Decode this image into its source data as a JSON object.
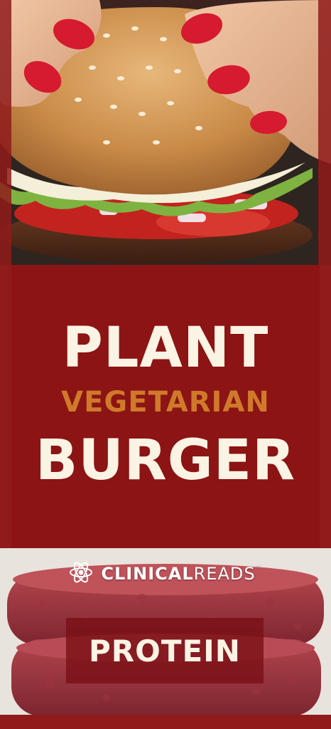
{
  "title": {
    "line1": "PLANT",
    "line2": "VEGETARIAN",
    "line3": "BURGER"
  },
  "brand": {
    "name_part1": "CLINICAL",
    "name_part2": "READS",
    "trademark": "™",
    "logo_icon": "atom-brain-icon"
  },
  "tag": {
    "label": "PROTEIN"
  },
  "images": {
    "top": "hands-holding-burger-photo",
    "bottom": "raw-plant-patties-photo"
  },
  "colors": {
    "panel": "#8c1414",
    "title_light": "#fbf3e4",
    "title_accent": "#cf7a2b"
  }
}
